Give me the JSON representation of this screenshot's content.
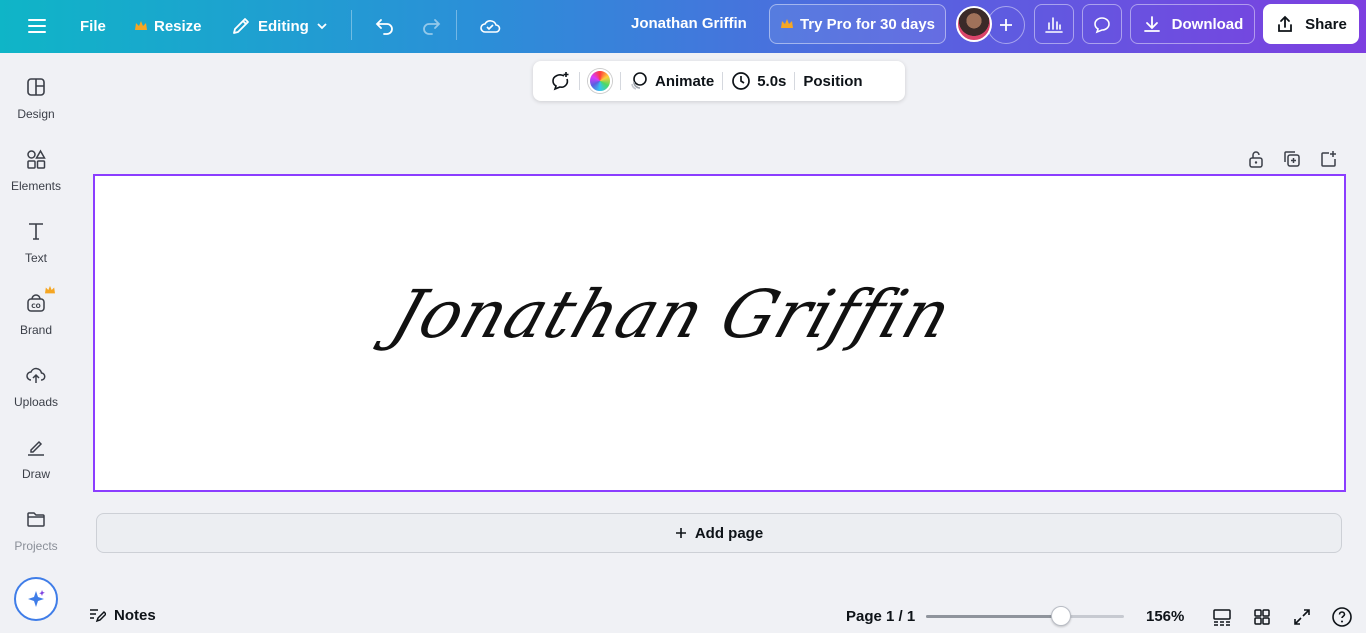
{
  "topbar": {
    "file_label": "File",
    "resize_label": "Resize",
    "editing_label": "Editing",
    "doc_title": "Jonathan Griffin",
    "pro_label": "Try Pro for 30 days",
    "download_label": "Download",
    "share_label": "Share"
  },
  "sidebar": {
    "items": [
      {
        "label": "Design",
        "icon": "layout-icon"
      },
      {
        "label": "Elements",
        "icon": "shapes-icon"
      },
      {
        "label": "Text",
        "icon": "text-icon"
      },
      {
        "label": "Brand",
        "icon": "brand-icon"
      },
      {
        "label": "Uploads",
        "icon": "cloud-upload-icon"
      },
      {
        "label": "Draw",
        "icon": "draw-icon"
      },
      {
        "label": "Projects",
        "icon": "folder-icon"
      }
    ]
  },
  "context_toolbar": {
    "animate_label": "Animate",
    "duration_label": "5.0s",
    "position_label": "Position"
  },
  "canvas": {
    "signature_text": "Jonathan Griffin"
  },
  "add_page_label": "Add page",
  "bottom": {
    "notes_label": "Notes",
    "page_info": "Page 1 / 1",
    "zoom_label": "156%",
    "zoom_fraction": 0.68
  },
  "colors": {
    "accent": "#8b3dff",
    "crown": "#f5a623"
  }
}
